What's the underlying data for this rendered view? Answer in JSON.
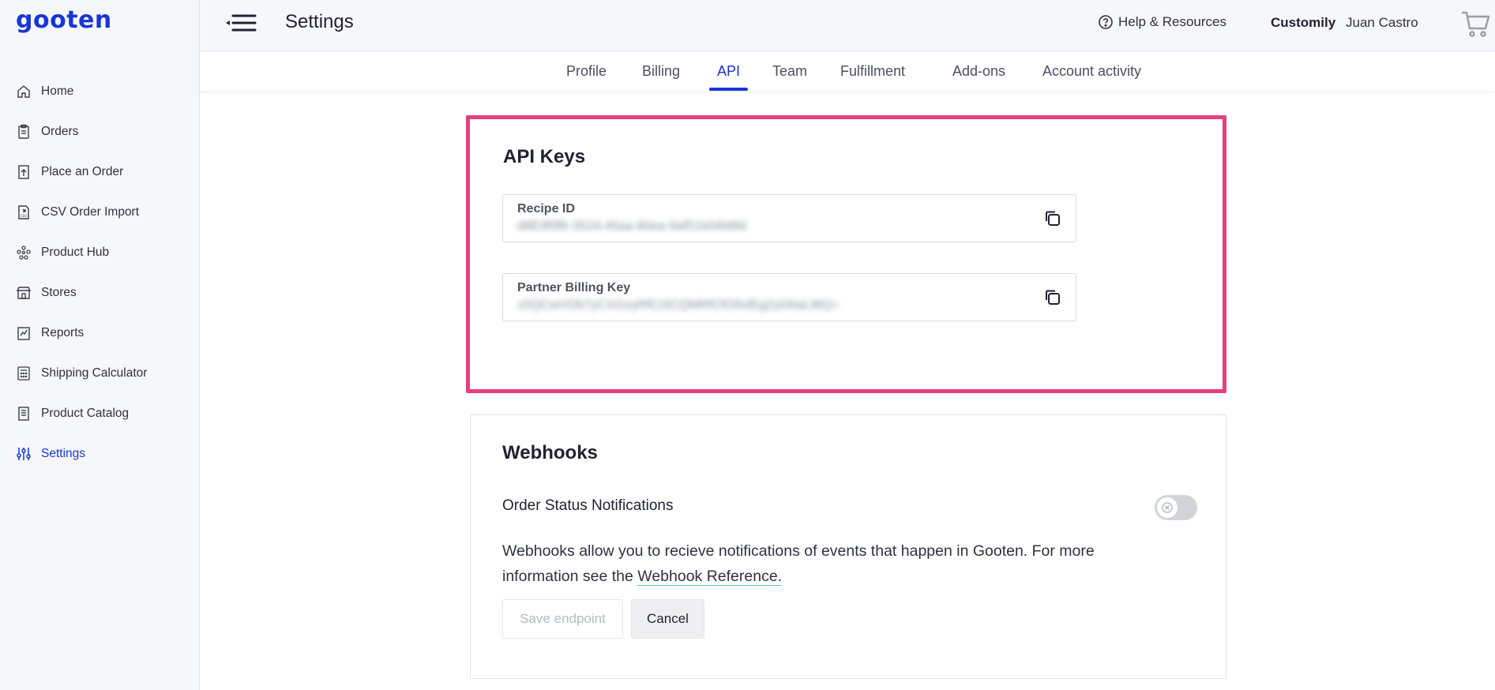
{
  "app": {
    "logo": "gooten"
  },
  "sidebar": {
    "items": [
      {
        "label": "Home",
        "icon": "home-icon"
      },
      {
        "label": "Orders",
        "icon": "orders-icon"
      },
      {
        "label": "Place an Order",
        "icon": "place-order-icon"
      },
      {
        "label": "CSV Order Import",
        "icon": "csv-icon"
      },
      {
        "label": "Product Hub",
        "icon": "product-hub-icon"
      },
      {
        "label": "Stores",
        "icon": "store-icon"
      },
      {
        "label": "Reports",
        "icon": "reports-icon"
      },
      {
        "label": "Shipping Calculator",
        "icon": "calculator-icon"
      },
      {
        "label": "Product Catalog",
        "icon": "catalog-icon"
      },
      {
        "label": "Settings",
        "icon": "settings-icon",
        "active": true
      }
    ]
  },
  "header": {
    "title": "Settings",
    "help_label": "Help & Resources",
    "brand": "Customily",
    "user": "Juan Castro"
  },
  "tabs": [
    {
      "label": "Profile"
    },
    {
      "label": "Billing"
    },
    {
      "label": "API",
      "active": true
    },
    {
      "label": "Team"
    },
    {
      "label": "Fulfillment"
    },
    {
      "label": "Add-ons"
    },
    {
      "label": "Account activity"
    }
  ],
  "api_keys": {
    "title": "API Keys",
    "recipe_id": {
      "label": "Recipe ID",
      "value": "d8E9f0f6-352d-45aa-80ea-9af51b04b8fd"
    },
    "partner_billing_key": {
      "label": "Partner Billing Key",
      "value": "z5QCwVOb7yCXGzyRfCI3CQMRfCfO9vlEgZy04iaL8tQ="
    }
  },
  "webhooks": {
    "title": "Webhooks",
    "order_status_label": "Order Status Notifications",
    "toggle_on": false,
    "description_prefix": "Webhooks allow you to recieve notifications of events that happen in Gooten. For more information see the ",
    "reference_link": "Webhook Reference.",
    "save_label": "Save endpoint",
    "cancel_label": "Cancel"
  },
  "colors": {
    "accent": "#1736d8",
    "highlight": "#e63f7f",
    "sidebar_bg": "#f6f7fb"
  }
}
